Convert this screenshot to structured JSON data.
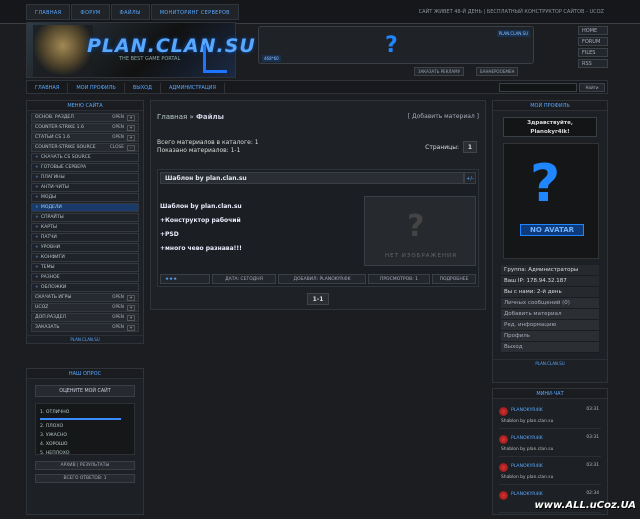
{
  "top_nav": [
    "Главная",
    "Форум",
    "Файлы",
    "Мониторинг серверов"
  ],
  "top_note": "Сайт живет 48-й день | Бесплатный конструктор сайтов - uCoz",
  "logo": {
    "title": "PLAN.CLAN.SU",
    "subtitle": "THE BEST GAME PORTAL"
  },
  "ad": {
    "tag_left": "468*60",
    "tag_right": "PLAN.CLAN.SU",
    "btn_order": "Заказать рекламу",
    "btn_banner": "Баннерообмен"
  },
  "side_buttons": [
    "Home",
    "Forum",
    "Files",
    "RSS"
  ],
  "menu2": [
    "Главная",
    "Мои профиль",
    "Выход",
    "Администрация"
  ],
  "search_btn": "Найти",
  "categories_title": "Меню сайта",
  "categories": [
    {
      "label": "Основ. раздел",
      "state": "Open",
      "btn": "+",
      "sub": false,
      "hl": false
    },
    {
      "label": "Counter-Strike 1.6",
      "state": "Open",
      "btn": "+",
      "sub": false,
      "hl": false
    },
    {
      "label": "Статьи CS 1.6",
      "state": "Open",
      "btn": "+",
      "sub": false,
      "hl": false
    },
    {
      "label": "Counter-Strike Source",
      "state": "Close",
      "btn": "-",
      "sub": false,
      "hl": false
    },
    {
      "label": "Скачать CS Source",
      "state": "",
      "btn": "",
      "sub": true,
      "hl": false
    },
    {
      "label": "Готовые сервера",
      "state": "",
      "btn": "",
      "sub": true,
      "hl": false
    },
    {
      "label": "Плагины",
      "state": "",
      "btn": "",
      "sub": true,
      "hl": false
    },
    {
      "label": "Анти-читы",
      "state": "",
      "btn": "",
      "sub": true,
      "hl": false
    },
    {
      "label": "Моды",
      "state": "",
      "btn": "",
      "sub": true,
      "hl": false
    },
    {
      "label": "Модели",
      "state": "",
      "btn": "",
      "sub": true,
      "hl": true
    },
    {
      "label": "Спрайты",
      "state": "",
      "btn": "",
      "sub": true,
      "hl": false
    },
    {
      "label": "Карты",
      "state": "",
      "btn": "",
      "sub": true,
      "hl": false
    },
    {
      "label": "Патчи",
      "state": "",
      "btn": "",
      "sub": true,
      "hl": false
    },
    {
      "label": "Уровни",
      "state": "",
      "btn": "",
      "sub": true,
      "hl": false
    },
    {
      "label": "Конфиги",
      "state": "",
      "btn": "",
      "sub": true,
      "hl": false
    },
    {
      "label": "Темы",
      "state": "",
      "btn": "",
      "sub": true,
      "hl": false
    },
    {
      "label": "Разное",
      "state": "",
      "btn": "",
      "sub": true,
      "hl": false
    },
    {
      "label": "Обложки",
      "state": "",
      "btn": "",
      "sub": true,
      "hl": false
    },
    {
      "label": "Скачать игры",
      "state": "Open",
      "btn": "+",
      "sub": false,
      "hl": false
    },
    {
      "label": "uCoz",
      "state": "Open",
      "btn": "+",
      "sub": false,
      "hl": false
    },
    {
      "label": "Доп.раздел",
      "state": "Open",
      "btn": "+",
      "sub": false,
      "hl": false
    },
    {
      "label": "Заказать",
      "state": "Open",
      "btn": "+",
      "sub": false,
      "hl": false
    }
  ],
  "left_footer": "PLAN.CLAN.SU",
  "poll": {
    "title": "Наш опрос",
    "question": "Оцените мой сайт",
    "options": [
      "1. Отлично",
      "2. Плохо",
      "3. Ужасно",
      "4. Хорошо",
      "5. Неплохо"
    ],
    "first_share": 0.9,
    "btn_results": "Архив | Результаты",
    "btn_total": "Всего ответов: 1"
  },
  "main": {
    "crumb_home": "Главная",
    "crumb_sep": " » ",
    "crumb_cur": "Файлы",
    "add_material": "[ Добавить материал ]",
    "total_materials": "Всего материалов в каталоге: 1",
    "shown_materials": "Показано материалов: 1-1",
    "pages_label": "Страницы:",
    "page_num": "1",
    "bottom_pager": "1-1"
  },
  "entry": {
    "title": "Шаблон by plan.clan.su",
    "toggle": "+/-",
    "lines": [
      "Шаблон by plan.clan.su",
      "+Конструктор рабочий",
      "+PSD",
      "+много чево разнава!!!"
    ],
    "no_image": "НЕТ ИЗОБРАЖЕНИЯ",
    "rating": "★★★",
    "meta": [
      "Дата: Сегодня",
      "Добавил: PlanoKyr4ik",
      "Просмотров: 1",
      "Подробнее"
    ]
  },
  "user": {
    "title": "Мой профиль",
    "greeting": "Здравствуйте,",
    "name": "Planokyr4ik!",
    "no_avatar": "NO AVATAR",
    "info": [
      {
        "t": "Группа: Администраторы",
        "lk": false
      },
      {
        "t": "Ваш IP: 178.94.32.187",
        "lk": false
      },
      {
        "t": "Вы с нами: 2-й день",
        "lk": false
      },
      {
        "t": "Личных сообщений (0)",
        "lk": true
      },
      {
        "t": "Добавить материал",
        "lk": true
      },
      {
        "t": "Ред. информацию",
        "lk": true
      },
      {
        "t": "Профиль",
        "lk": true
      },
      {
        "t": "Выход",
        "lk": true
      }
    ],
    "footer": "PLAN.CLAN.SU"
  },
  "chat": {
    "title": "Мини-чат",
    "messages": [
      {
        "name": "PLANOKYR4IK",
        "time": "03:31",
        "text": "Shablon by plan.clan.su"
      },
      {
        "name": "PLANOKYR4IK",
        "time": "03:31",
        "text": "Shablon by plan.clan.su"
      },
      {
        "name": "PLANOKYR4IK",
        "time": "03:31",
        "text": "Shablon by plan.clan.su"
      },
      {
        "name": "PLANOKYR4IK",
        "time": "02:34",
        "text": ""
      }
    ]
  },
  "watermark": "www.ALL.uCoz.UA"
}
